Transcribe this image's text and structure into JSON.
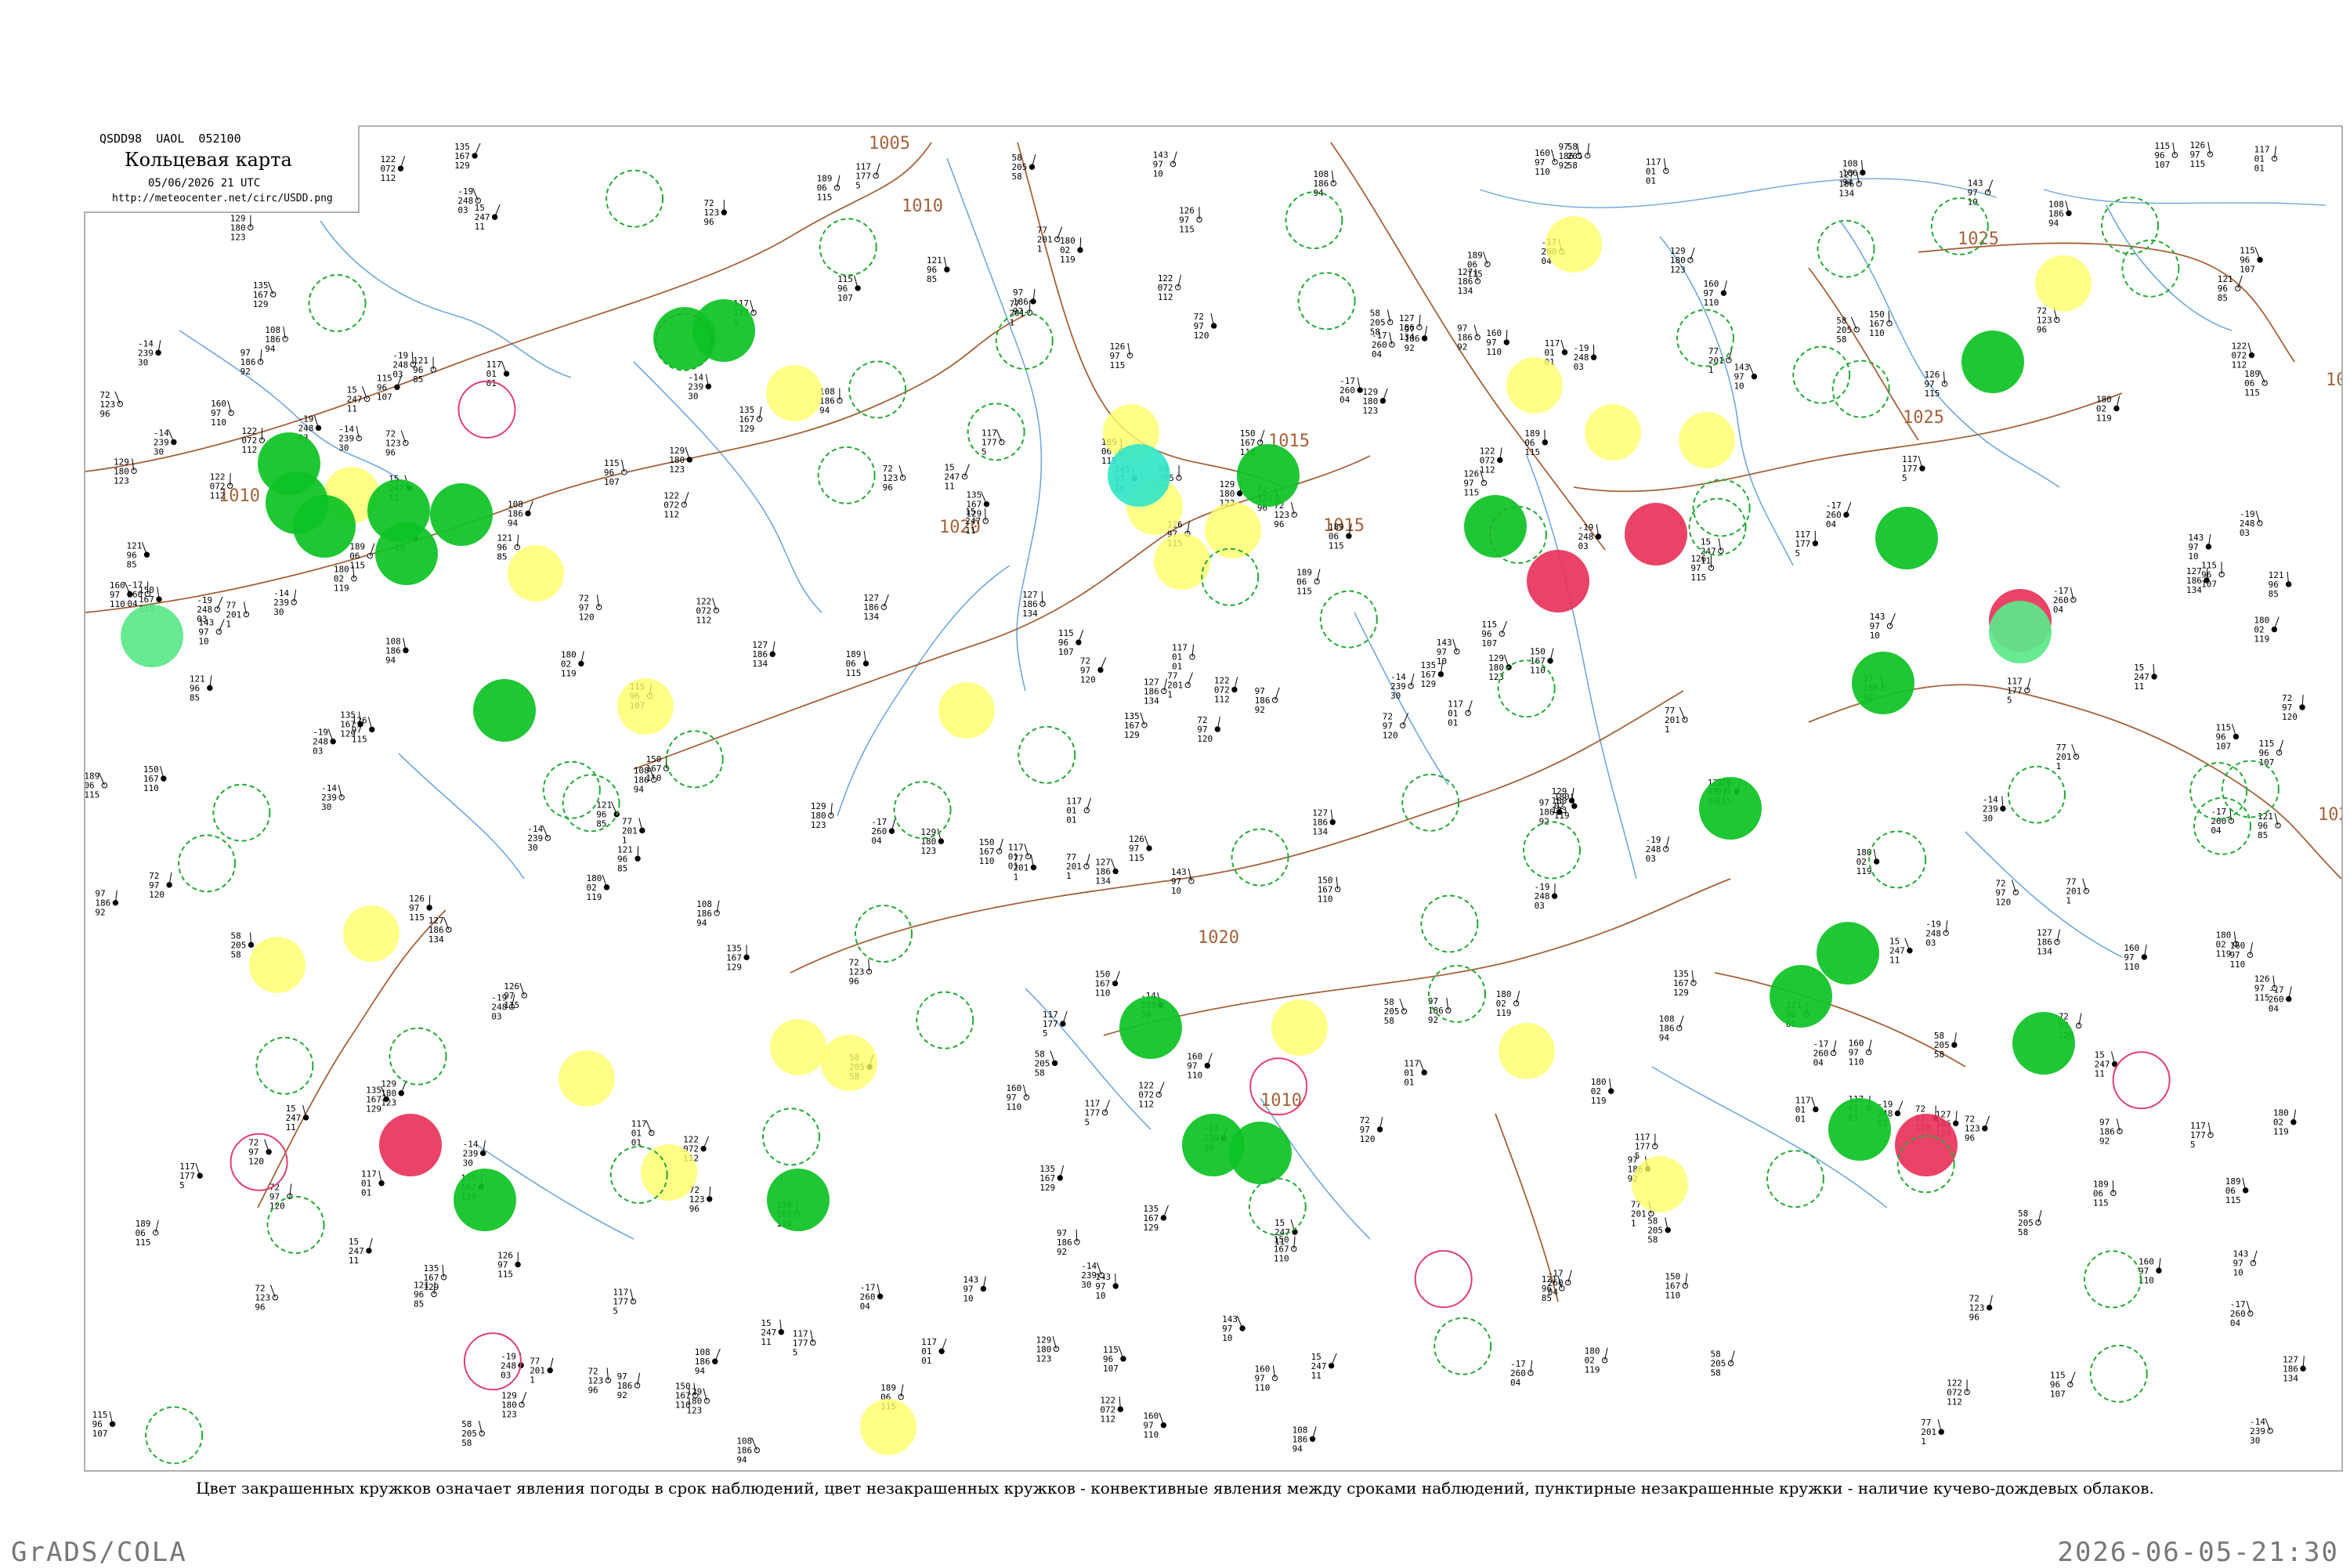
{
  "header": {
    "code_line": "QSDD98  UAOL  052100",
    "title": "Кольцевая карта",
    "datetime": "05/06/2026 21 UTC",
    "url": "http://meteocenter.net/circ/USDD.png"
  },
  "caption": "Цвет закрашенных кружков означает явления погоды в срок наблюдений, цвет незакрашенных кружков - конвективные явления между сроками наблюдений, пунктирные незакрашенные кружки - наличие кучево-дождевых облаков.",
  "footer": {
    "left": "GrADS/COLA",
    "right": "2026-06-05-21:30"
  },
  "colors": {
    "isobar": "#a5623a",
    "river": "#6fa8dc",
    "precip_green": "#0cc224",
    "thunder_red": "#e8335a",
    "fog_yellow": "#ffff66",
    "snow_cyan": "#33e6c8",
    "light_green": "#5be88a",
    "cb_dashed_green": "#22aa33",
    "convective_red": "#e04070"
  },
  "isobars": [
    {
      "label": "1005"
    },
    {
      "label": "1010"
    },
    {
      "label": "1010"
    },
    {
      "label": "1015"
    },
    {
      "label": "1015"
    },
    {
      "label": "1020"
    },
    {
      "label": "1020"
    },
    {
      "label": "1025"
    },
    {
      "label": "1025"
    },
    {
      "label": "1010"
    },
    {
      "label": "102"
    },
    {
      "label": "10"
    }
  ],
  "stations_filled": [
    {
      "kind": "precip_green"
    },
    {
      "kind": "precip_green"
    },
    {
      "kind": "snow_cyan"
    },
    {
      "kind": "precip_green"
    },
    {
      "kind": "precip_green"
    },
    {
      "kind": "precip_green"
    },
    {
      "kind": "precip_green"
    },
    {
      "kind": "precip_green"
    },
    {
      "kind": "precip_green"
    },
    {
      "kind": "precip_green"
    },
    {
      "kind": "light_green"
    },
    {
      "kind": "precip_green"
    },
    {
      "kind": "thunder_red"
    },
    {
      "kind": "thunder_red"
    },
    {
      "kind": "precip_green"
    },
    {
      "kind": "precip_green"
    },
    {
      "kind": "precip_green"
    },
    {
      "kind": "precip_green"
    },
    {
      "kind": "precip_green"
    },
    {
      "kind": "precip_green"
    },
    {
      "kind": "precip_green"
    },
    {
      "kind": "precip_green"
    },
    {
      "kind": "thunder_red"
    },
    {
      "kind": "precip_green"
    },
    {
      "kind": "thunder_red"
    },
    {
      "kind": "precip_green"
    },
    {
      "kind": "light_green"
    },
    {
      "kind": "precip_green"
    },
    {
      "kind": "precip_green"
    },
    {
      "kind": "thunder_red"
    },
    {
      "kind": "precip_green"
    },
    {
      "kind": "precip_green"
    }
  ],
  "stations_yellow": [
    {},
    {},
    {},
    {},
    {},
    {},
    {},
    {},
    {},
    {},
    {},
    {},
    {},
    {},
    {},
    {},
    {},
    {},
    {},
    {},
    {},
    {},
    {},
    {}
  ],
  "sample_readings": [
    {
      "t": "143",
      "p": "97",
      "v": "10"
    },
    {
      "t": "117",
      "p": "01",
      "v": "01"
    },
    {
      "t": "-14",
      "p": "239",
      "v": "30"
    },
    {
      "t": "-17",
      "p": "260",
      "v": "04"
    },
    {
      "t": "-19",
      "p": "248",
      "v": "03"
    },
    {
      "t": "15",
      "p": "247",
      "v": "11"
    },
    {
      "t": "126",
      "p": "97",
      "v": "115"
    },
    {
      "t": "77",
      "p": "201",
      "v": "1"
    },
    {
      "t": "58",
      "p": "205",
      "v": "58"
    },
    {
      "t": "189",
      "p": "06",
      "v": "115"
    },
    {
      "t": "127",
      "p": "186",
      "v": "134"
    },
    {
      "t": "117",
      "p": "177",
      "v": "5"
    },
    {
      "t": "135",
      "p": "167",
      "v": "129"
    },
    {
      "t": "72",
      "p": "123",
      "v": "96"
    },
    {
      "t": "121",
      "p": "96",
      "v": "85"
    },
    {
      "t": "115",
      "p": "96",
      "v": "107"
    },
    {
      "t": "97",
      "p": "186",
      "v": "92"
    },
    {
      "t": "129",
      "p": "180",
      "v": "123"
    },
    {
      "t": "122",
      "p": "072",
      "v": "112"
    },
    {
      "t": "160",
      "p": "97",
      "v": "110"
    },
    {
      "t": "108",
      "p": "186",
      "v": "94"
    },
    {
      "t": "180",
      "p": "02",
      "v": "119"
    },
    {
      "t": "150",
      "p": "167",
      "v": "110"
    },
    {
      "t": "72",
      "p": "97",
      "v": "120"
    }
  ]
}
